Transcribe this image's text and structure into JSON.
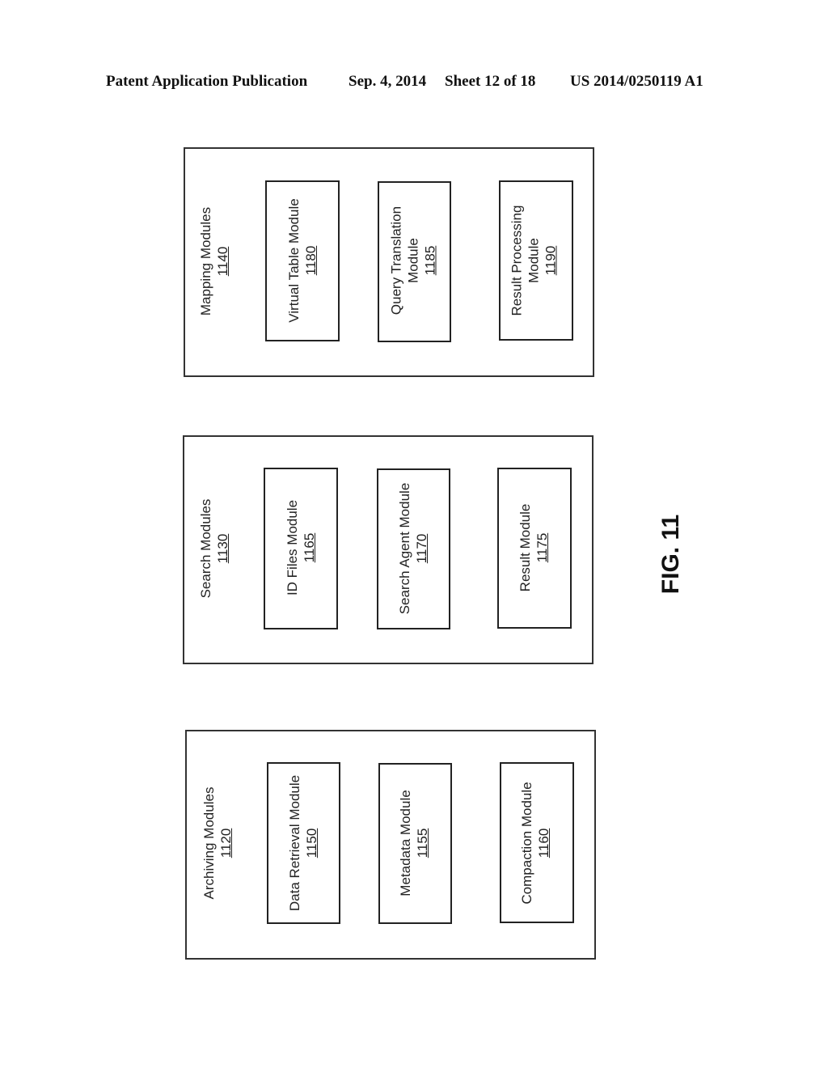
{
  "header": {
    "publication": "Patent Application Publication",
    "date": "Sep. 4, 2014",
    "sheet": "Sheet 12 of 18",
    "number": "US 2014/0250119 A1"
  },
  "figure_label": "FIG. 11",
  "groups": [
    {
      "name": "Mapping Modules",
      "ref": "1140",
      "modules": [
        {
          "name": "Virtual Table Module",
          "name2": "",
          "ref": "1180"
        },
        {
          "name": "Query Translation",
          "name2": "Module",
          "ref": "1185"
        },
        {
          "name": "Result Processing",
          "name2": "Module",
          "ref": "1190"
        }
      ]
    },
    {
      "name": "Search Modules",
      "ref": "1130",
      "modules": [
        {
          "name": "ID Files Module",
          "name2": "",
          "ref": "1165"
        },
        {
          "name": "Search Agent Module",
          "name2": "",
          "ref": "1170"
        },
        {
          "name": "Result Module",
          "name2": "",
          "ref": "1175"
        }
      ]
    },
    {
      "name": "Archiving Modules",
      "ref": "1120",
      "modules": [
        {
          "name": "Data Retrieval Module",
          "name2": "",
          "ref": "1150"
        },
        {
          "name": "Metadata Module",
          "name2": "",
          "ref": "1155"
        },
        {
          "name": "Compaction Module",
          "name2": "",
          "ref": "1160"
        }
      ]
    }
  ]
}
